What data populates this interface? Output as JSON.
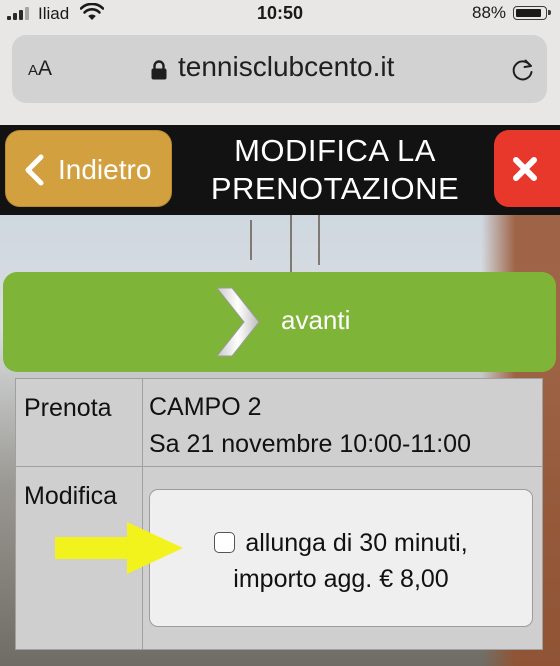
{
  "status_bar": {
    "carrier": "Iliad",
    "time": "10:50",
    "battery_text": "88%"
  },
  "browser": {
    "text_size_small": "A",
    "text_size_large": "A",
    "url": "tennisclubcento.it"
  },
  "header": {
    "back_label": "Indietro",
    "title_line1": "MODIFICA LA",
    "title_line2": "PRENOTAZIONE"
  },
  "avanti": {
    "label": "avanti"
  },
  "table": {
    "row1": {
      "label": "Prenota",
      "court": "CAMPO 2",
      "datetime": "Sa 21 novembre 10:00-11:00"
    },
    "row2": {
      "label": "Modifica",
      "option_line1": "allunga di 30 minuti,",
      "option_line2": "importo agg. € 8,00"
    }
  },
  "colors": {
    "back_button": "#d3a040",
    "close_button": "#e8382c",
    "avanti_button": "#7eb437",
    "header_bg": "#121212",
    "annotation_arrow": "#f2f21c"
  },
  "icons": {
    "back": "chevron-left-icon",
    "close": "close-x-icon",
    "avanti": "chevron-right-icon",
    "lock": "lock-icon",
    "reload": "reload-icon",
    "wifi": "wifi-icon",
    "annotation": "yellow-arrow-icon"
  }
}
